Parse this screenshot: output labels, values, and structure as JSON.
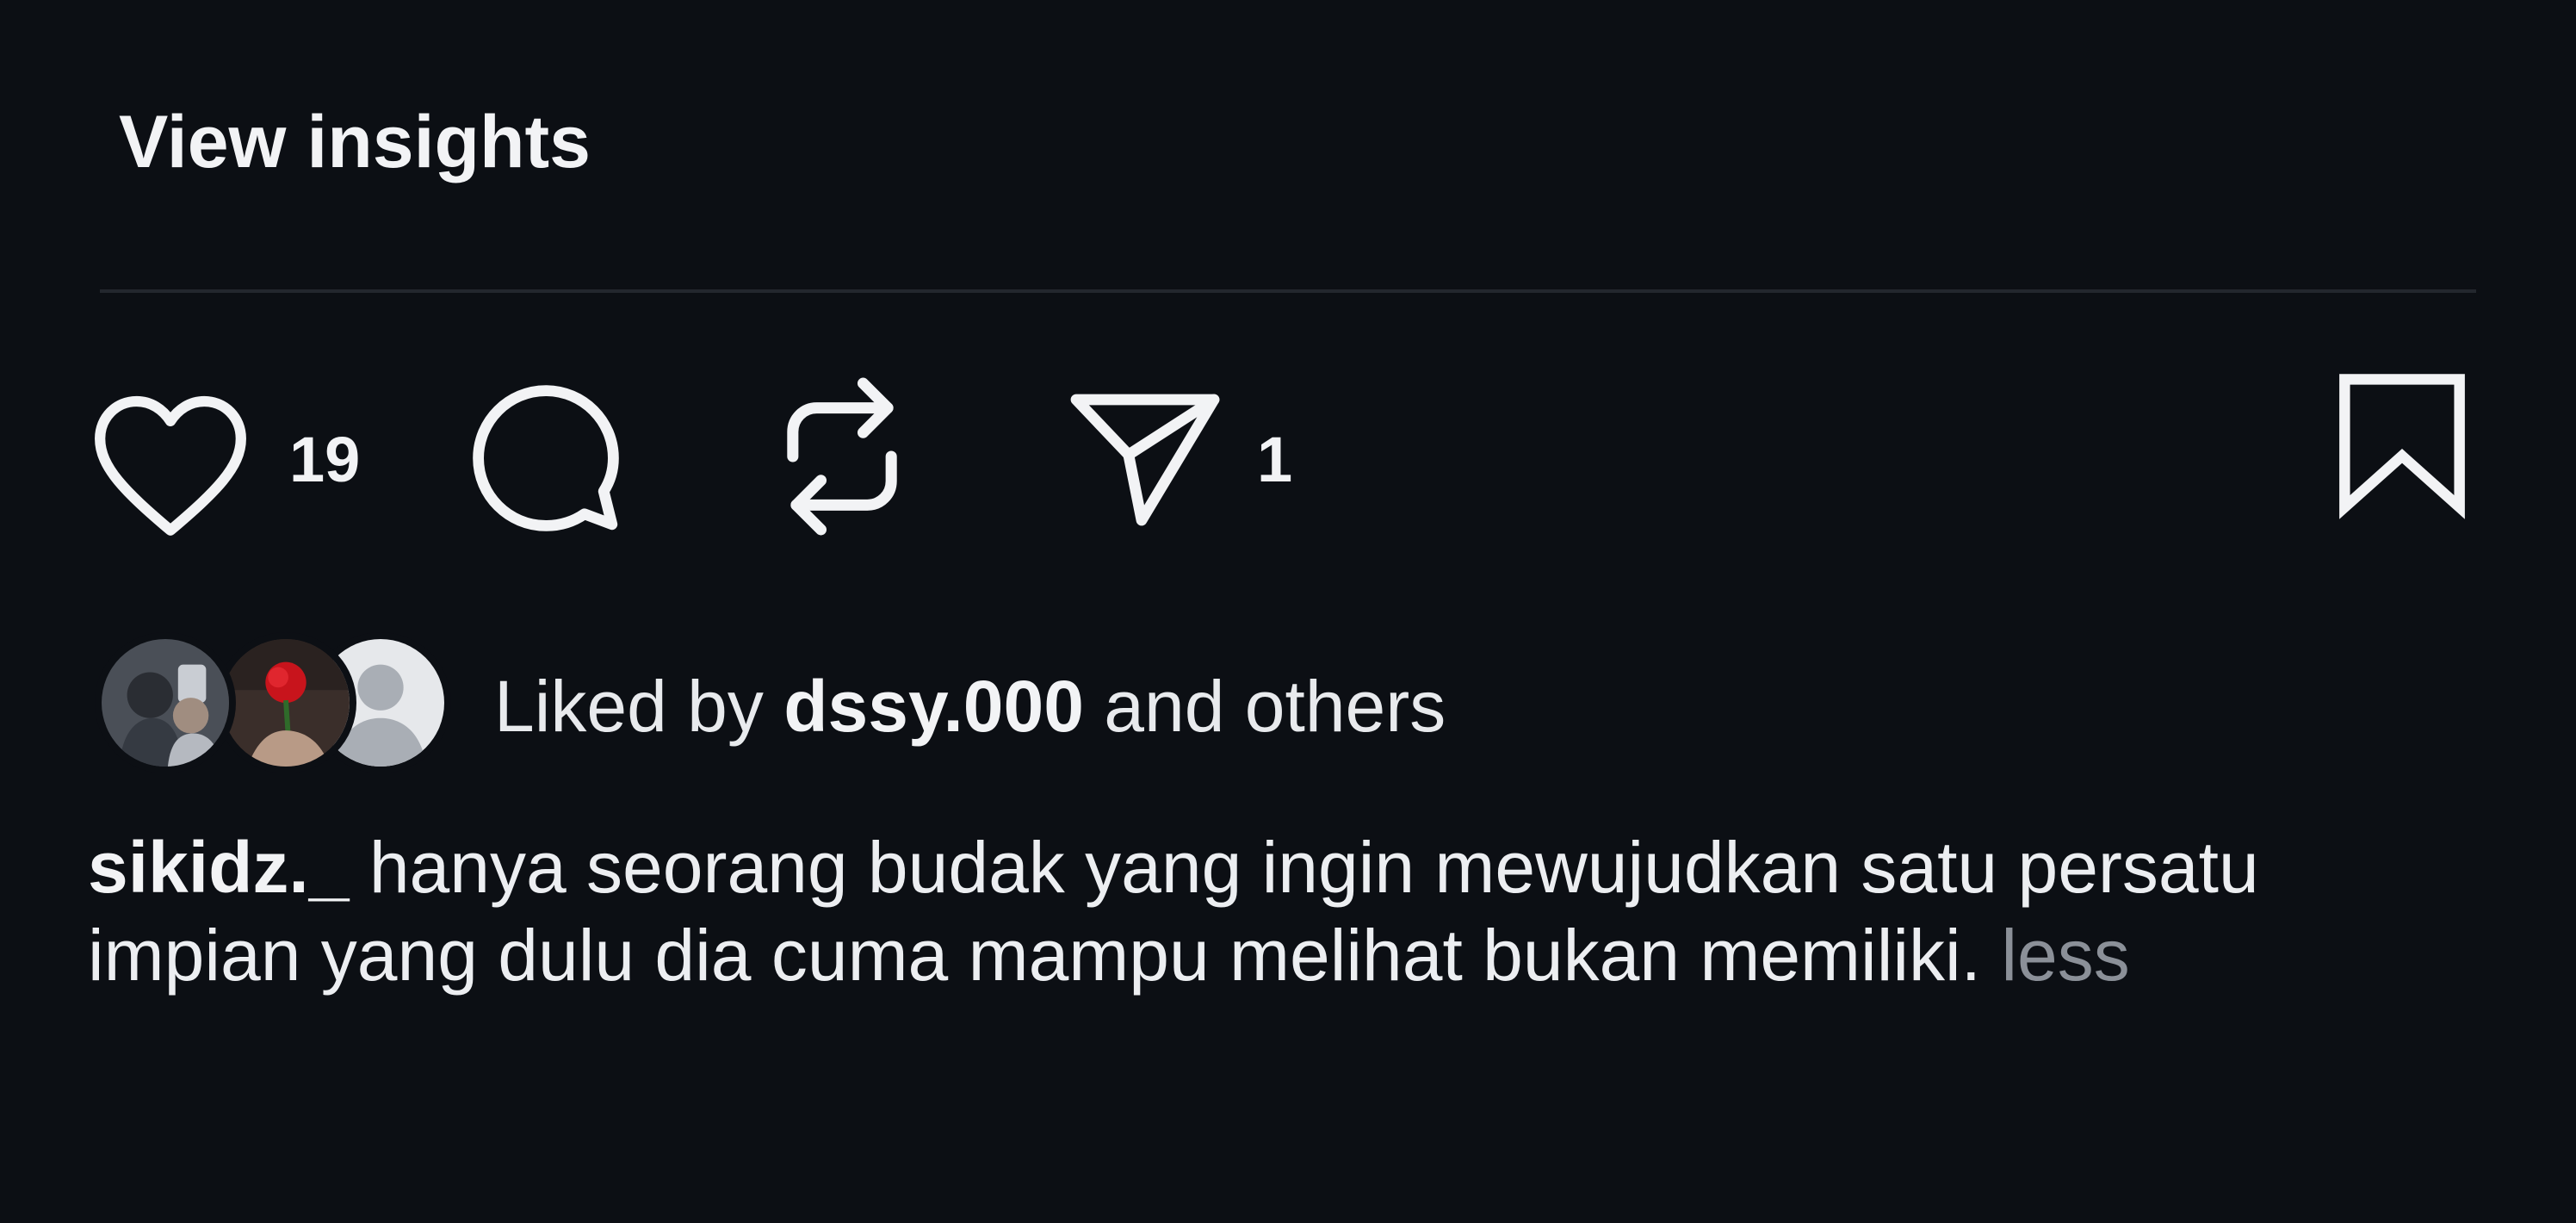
{
  "post": {
    "view_insights_label": "View insights"
  },
  "actions": {
    "like_icon": "heart-icon",
    "like_count": "19",
    "comment_icon": "speech-bubble-icon",
    "repost_icon": "repost-arrows-icon",
    "share_icon": "paper-plane-icon",
    "share_count": "1",
    "bookmark_icon": "bookmark-icon"
  },
  "likes": {
    "prefix": "Liked by",
    "username": "dssy.000",
    "suffix": "and others"
  },
  "caption": {
    "username": "sikidz._",
    "text": "hanya seorang budak yang ingin mewujudkan satu persatu impian yang dulu dia cuma mampu melihat bukan memiliki.",
    "toggle_label": "less"
  },
  "colors": {
    "background": "#0c0f14",
    "text": "#f2f3f5",
    "muted": "#8b9098",
    "divider": "#23272e"
  }
}
